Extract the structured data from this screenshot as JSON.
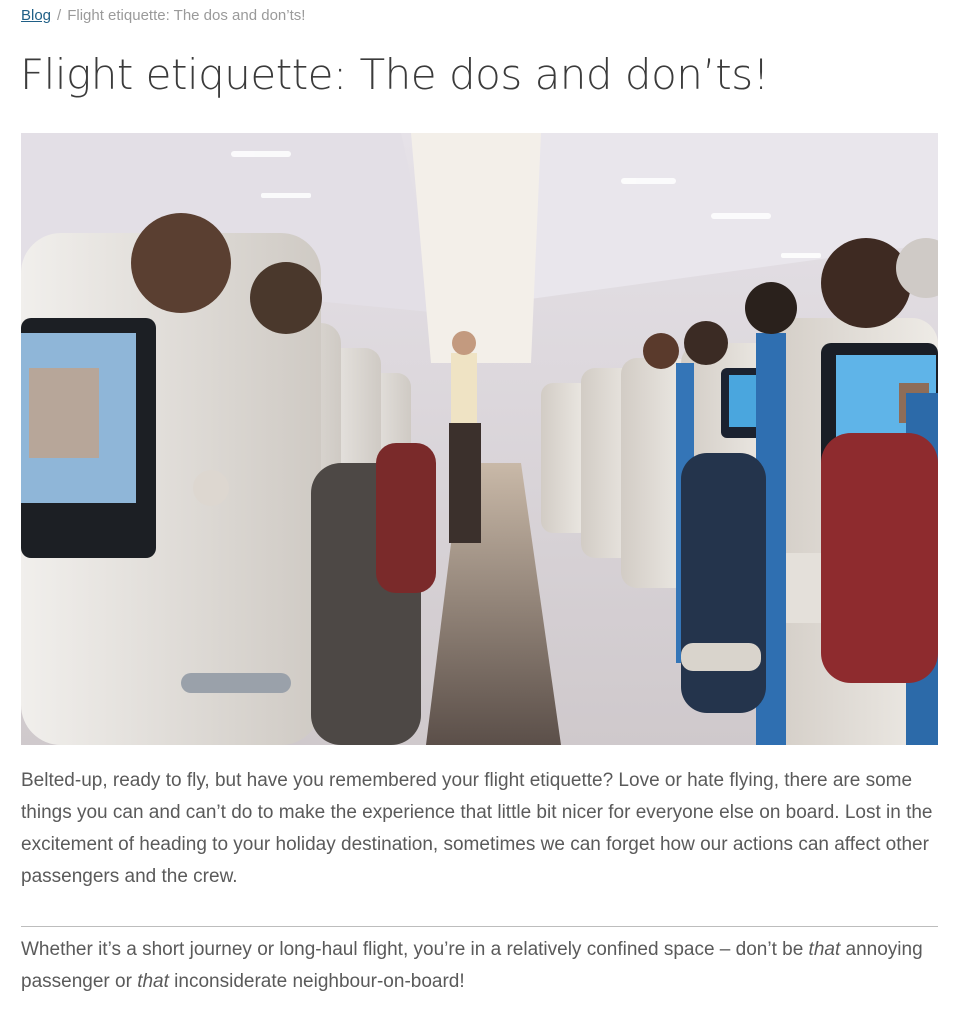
{
  "breadcrumb": {
    "root": "Blog",
    "separator": "/",
    "current": "Flight etiquette: The dos and don’ts!"
  },
  "article": {
    "title": "Flight etiquette: The dos and don’ts!",
    "intro": "Belted-up, ready to fly, but have you remembered your flight etiquette? Love or hate flying, there are some things you can and can’t do to make the experience that little bit nicer for everyone else on board. Lost in the excitement of heading to your holiday destination, sometimes we can forget how our actions can affect other passengers and the crew.",
    "lead": {
      "part1": "Whether it’s a short journey or long-haul flight, you’re in a relatively confined space – don’t be ",
      "em1": "that",
      "part2": " annoying passenger or ",
      "em2": "that",
      "part3": " inconsiderate neighbour-on-board!"
    }
  },
  "colors": {
    "link": "#1f5f86",
    "text": "#5a5a5a",
    "title": "#3b3b3b",
    "breadcrumb_muted": "#9a9a9a"
  }
}
